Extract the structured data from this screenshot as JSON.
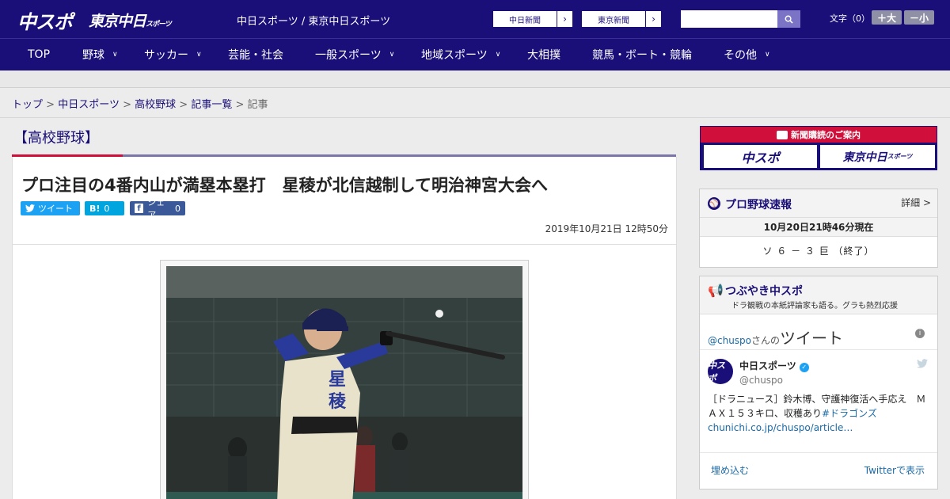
{
  "header": {
    "logo_chuspo": "中スポ",
    "logo_tokyo": "東京中日",
    "logo_tokyo_sub": "スポーツ",
    "site_link": "中日スポーツ / 東京中日スポーツ",
    "ext_links": [
      {
        "label": "中日新聞"
      },
      {
        "label": "東京新聞"
      }
    ],
    "search_placeholder": "",
    "fontsize_label": "文字（0）",
    "fontsize_up": "＋大",
    "fontsize_down": "－小"
  },
  "nav": {
    "items": [
      {
        "label": "TOP"
      },
      {
        "label": "野球"
      },
      {
        "label": "サッカー"
      },
      {
        "label": "芸能・社会"
      },
      {
        "label": "一般スポーツ"
      },
      {
        "label": "地域スポーツ"
      },
      {
        "label": "大相撲"
      },
      {
        "label": "競馬・ボート・競輪"
      },
      {
        "label": "その他"
      }
    ]
  },
  "breadcrumb": {
    "items": [
      "トップ",
      "中日スポーツ",
      "高校野球",
      "記事一覧"
    ],
    "current": "記事",
    "sep": ">"
  },
  "article": {
    "section": "【高校野球】",
    "headline": "プロ注目の4番内山が満塁本塁打　星稜が北信越制して明治神宮大会へ",
    "share": {
      "tweet": "ツイート",
      "hatena": "B!",
      "hatena_count": "0",
      "facebook": "シェア",
      "facebook_count": "0"
    },
    "date": "2019年10月21日 12時50分",
    "photo_jersey_text": "星稜"
  },
  "sidebar": {
    "ad_title": "新聞購読のご案内",
    "ad_logo_1": "中スポ",
    "ad_logo_2": "東京中日",
    "ad_logo_2_sub": "スポーツ",
    "baseball": {
      "title": "プロ野球速報",
      "more": "詳細 >",
      "as_of": "10月20日21時46分現在",
      "score": "ソ ６ － ３ 巨 （終了）"
    },
    "twitter": {
      "title": "つぶやき中スポ",
      "subtitle": "ドラ観戦の本紙評論家も語る。グラも熱烈応援",
      "user_handle_label": "@chuspo",
      "user_suffix": "さんの",
      "tweet_word": "ツイート",
      "account_name": "中日スポーツ",
      "account_handle": "@chuspo",
      "avatar_text": "中スポ",
      "tweet_text_1": "［ドラニュース］鈴木博、守護神復活へ手応え　ＭＡＸ１５３キロ、収穫あり",
      "tweet_hashtag": "#ドラゴンズ",
      "tweet_link": "chunichi.co.jp/chuspo/article…",
      "embed": "埋め込む",
      "view_on": "Twitterで表示"
    }
  },
  "colors": {
    "brand": "#1a0f78",
    "accent_red": "#d0103a",
    "twitter": "#1da1f2",
    "hatena": "#00a4de",
    "facebook": "#3b5998"
  }
}
